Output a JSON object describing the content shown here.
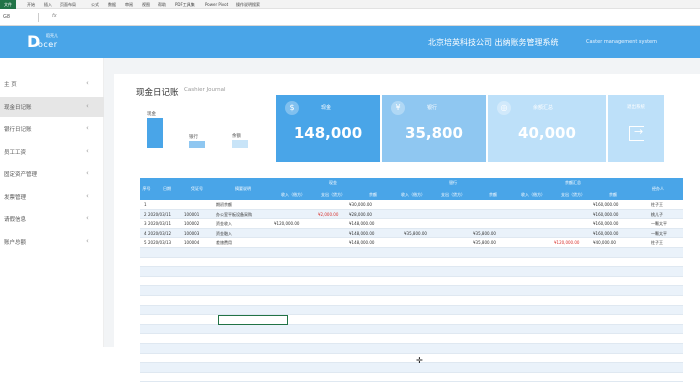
{
  "ribbon": {
    "tabs": [
      "文件",
      "开始",
      "插入",
      "页面布局",
      "公式",
      "数据",
      "审阅",
      "视图",
      "帮助",
      "PDF工具集",
      "Power Pivot",
      "操作说明搜索"
    ]
  },
  "formula_bar": {
    "cell_ref": "G8",
    "fx": "fx"
  },
  "header": {
    "logo_letter": "D",
    "logo_word": "ocer",
    "logo_small": "稻壳儿",
    "title": "北京培英科技公司  出纳账务管理系统",
    "subtitle": "Caster management system"
  },
  "sidebar": {
    "items": [
      {
        "label": "主  页",
        "selected": false
      },
      {
        "label": "现金日记账",
        "selected": true
      },
      {
        "label": "银行日记账",
        "selected": false
      },
      {
        "label": "员工工资",
        "selected": false
      },
      {
        "label": "固定资产管理",
        "selected": false
      },
      {
        "label": "发票管理",
        "selected": false
      },
      {
        "label": "请假信息",
        "selected": false
      },
      {
        "label": "账户总额",
        "selected": false
      }
    ]
  },
  "panel": {
    "title": "现金日记账",
    "subtitle": "Cashier Journal"
  },
  "mini_chart": {
    "labels": [
      "现金",
      "银行",
      "余额"
    ],
    "values": [
      148000,
      35800,
      40000
    ]
  },
  "cards": [
    {
      "label": "现金",
      "value": "148,000",
      "icon": "money-bag-icon",
      "color": "#49a5e8"
    },
    {
      "label": "银行",
      "value": "35,800",
      "icon": "bank-icon",
      "color": "#8fc7f1"
    },
    {
      "label": "余额汇总",
      "value": "40,000",
      "icon": "piggy-bank-icon",
      "color": "#bde0f9"
    }
  ],
  "exit": {
    "label": "退出系统",
    "icon": "exit-icon"
  },
  "table": {
    "headers": {
      "seq": "序号",
      "date": "日期",
      "voucher": "凭证号",
      "summary": "摘要说明",
      "cash": "现金",
      "bank": "银行",
      "balance": "余额汇总",
      "handler": "经办人"
    },
    "subheaders": [
      "收入（借方）",
      "支出（贷方）",
      "余额",
      "收入（借方）",
      "支出（贷方）",
      "余额",
      "收入（借方）",
      "支出（贷方）",
      "余额"
    ],
    "rows": [
      {
        "seq": "1",
        "date": "",
        "voucher": "",
        "summary": "期初余额",
        "c_in": "",
        "c_out": "",
        "c_bal": "¥30,000.00",
        "b_in": "",
        "b_out": "",
        "b_bal": "",
        "t_in": "",
        "t_out": "",
        "t_bal": "¥160,000.00",
        "handler": "柱子王"
      },
      {
        "seq": "2",
        "date": "2020/03/11",
        "voucher": "100001",
        "summary": "办公室平板设备采购",
        "c_in": "",
        "c_out": "¥2,000.00",
        "c_bal": "¥28,000.00",
        "b_in": "",
        "b_out": "",
        "b_bal": "",
        "t_in": "",
        "t_out": "",
        "t_bal": "¥160,000.00",
        "handler": "桃儿子"
      },
      {
        "seq": "3",
        "date": "2020/03/11",
        "voucher": "100002",
        "summary": "资金收入",
        "c_in": "¥120,000.00",
        "c_out": "",
        "c_bal": "¥148,000.00",
        "b_in": "",
        "b_out": "",
        "b_bal": "",
        "t_in": "",
        "t_out": "",
        "t_bal": "¥160,000.00",
        "handler": "一颗太平"
      },
      {
        "seq": "4",
        "date": "2020/03/12",
        "voucher": "100003",
        "summary": "资金融入",
        "c_in": "",
        "c_out": "",
        "c_bal": "¥148,000.00",
        "b_in": "¥35,800.00",
        "b_out": "",
        "b_bal": "¥35,800.00",
        "t_in": "",
        "t_out": "",
        "t_bal": "¥160,000.00",
        "handler": "一颗太平"
      },
      {
        "seq": "5",
        "date": "2020/03/13",
        "voucher": "100004",
        "summary": "差旅费用",
        "c_in": "",
        "c_out": "",
        "c_bal": "¥148,000.00",
        "b_in": "",
        "b_out": "",
        "b_bal": "¥35,800.00",
        "t_in": "",
        "t_out": "¥120,000.00",
        "t_bal": "¥40,000.00",
        "handler": "柱子王"
      }
    ],
    "empty_rows": 14
  }
}
